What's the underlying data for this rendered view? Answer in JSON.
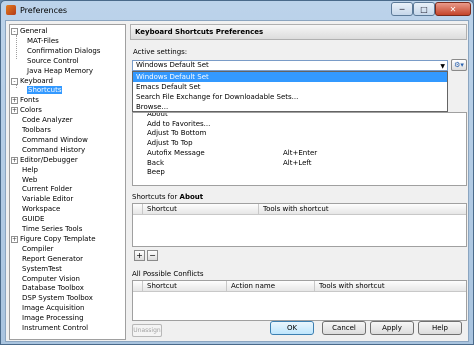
{
  "window": {
    "title": "Preferences",
    "min_glyph": "─",
    "max_glyph": "□",
    "close_glyph": "✕"
  },
  "tree": [
    {
      "label": "General",
      "indent": 0,
      "expander": "-",
      "selected": false
    },
    {
      "label": "MAT-Files",
      "indent": 1,
      "expander": "",
      "selected": false
    },
    {
      "label": "Confirmation Dialogs",
      "indent": 1,
      "expander": "",
      "selected": false
    },
    {
      "label": "Source Control",
      "indent": 1,
      "expander": "",
      "selected": false
    },
    {
      "label": "Java Heap Memory",
      "indent": 1,
      "expander": "",
      "selected": false
    },
    {
      "label": "Keyboard",
      "indent": 0,
      "expander": "-",
      "selected": false
    },
    {
      "label": "Shortcuts",
      "indent": 1,
      "expander": "",
      "selected": true
    },
    {
      "label": "Fonts",
      "indent": 0,
      "expander": "+",
      "selected": false
    },
    {
      "label": "Colors",
      "indent": 0,
      "expander": "+",
      "selected": false
    },
    {
      "label": "Code Analyzer",
      "indent": 0,
      "expander": "",
      "selected": false
    },
    {
      "label": "Toolbars",
      "indent": 0,
      "expander": "",
      "selected": false
    },
    {
      "label": "Command Window",
      "indent": 0,
      "expander": "",
      "selected": false
    },
    {
      "label": "Command History",
      "indent": 0,
      "expander": "",
      "selected": false
    },
    {
      "label": "Editor/Debugger",
      "indent": 0,
      "expander": "+",
      "selected": false
    },
    {
      "label": "Help",
      "indent": 0,
      "expander": "",
      "selected": false
    },
    {
      "label": "Web",
      "indent": 0,
      "expander": "",
      "selected": false
    },
    {
      "label": "Current Folder",
      "indent": 0,
      "expander": "",
      "selected": false
    },
    {
      "label": "Variable Editor",
      "indent": 0,
      "expander": "",
      "selected": false
    },
    {
      "label": "Workspace",
      "indent": 0,
      "expander": "",
      "selected": false
    },
    {
      "label": "GUIDE",
      "indent": 0,
      "expander": "",
      "selected": false
    },
    {
      "label": "Time Series Tools",
      "indent": 0,
      "expander": "",
      "selected": false
    },
    {
      "label": "Figure Copy Template",
      "indent": 0,
      "expander": "+",
      "selected": false
    },
    {
      "label": "Compiler",
      "indent": 0,
      "expander": "",
      "selected": false
    },
    {
      "label": "Report Generator",
      "indent": 0,
      "expander": "",
      "selected": false
    },
    {
      "label": "SystemTest",
      "indent": 0,
      "expander": "",
      "selected": false
    },
    {
      "label": "Computer Vision",
      "indent": 0,
      "expander": "",
      "selected": false
    },
    {
      "label": "Database Toolbox",
      "indent": 0,
      "expander": "",
      "selected": false
    },
    {
      "label": "DSP System Toolbox",
      "indent": 0,
      "expander": "",
      "selected": false
    },
    {
      "label": "Image Acquisition",
      "indent": 0,
      "expander": "",
      "selected": false
    },
    {
      "label": "Image Processing",
      "indent": 0,
      "expander": "",
      "selected": false
    },
    {
      "label": "Instrument Control",
      "indent": 0,
      "expander": "",
      "selected": false
    }
  ],
  "panel": {
    "header": "Keyboard Shortcuts Preferences",
    "active_settings_label": "Active settings:",
    "active_settings_value": "Windows Default Set",
    "dropdown_arrow": "▼",
    "gear_glyph": "⚙▾",
    "dropdown_options": [
      {
        "label": "Windows Default Set",
        "selected": true
      },
      {
        "label": "Emacs Default Set",
        "selected": false
      },
      {
        "label": "Search File Exchange for Downloadable Sets...",
        "selected": false
      },
      {
        "label": "Browse...",
        "selected": false
      }
    ],
    "commands": [
      {
        "action": "About",
        "shortcut": ""
      },
      {
        "action": "Add to Favorites...",
        "shortcut": ""
      },
      {
        "action": "Adjust To Bottom",
        "shortcut": ""
      },
      {
        "action": "Adjust To Top",
        "shortcut": ""
      },
      {
        "action": "Autofix Message",
        "shortcut": "Alt+Enter"
      },
      {
        "action": "Back",
        "shortcut": "Alt+Left"
      },
      {
        "action": "Beep",
        "shortcut": ""
      }
    ],
    "shortcuts_for_prefix": "Shortcuts for ",
    "shortcuts_for_target": "About",
    "shortcuts_columns": [
      "Shortcut",
      "Tools with shortcut"
    ],
    "add_glyph": "+",
    "remove_glyph": "−",
    "conflicts_label": "All Possible Conflicts",
    "conflicts_columns": [
      "Shortcut",
      "Action name",
      "Tools with shortcut"
    ],
    "unassign_label": "Unassign"
  },
  "buttons": {
    "ok": "OK",
    "cancel": "Cancel",
    "apply": "Apply",
    "help": "Help"
  }
}
